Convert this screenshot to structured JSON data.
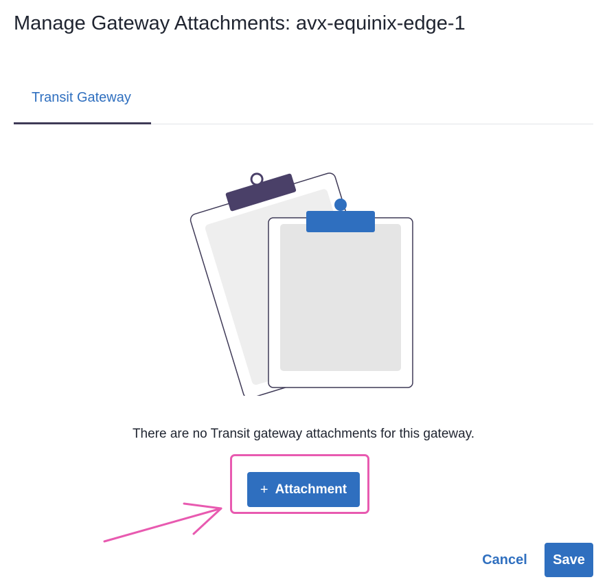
{
  "dialog": {
    "title": "Manage Gateway Attachments: avx-equinix-edge-1"
  },
  "tabs": [
    {
      "label": "Transit Gateway",
      "active": true
    }
  ],
  "empty_state": {
    "illustration": "clipboards-illustration",
    "message": "There are no Transit gateway attachments for this gateway."
  },
  "add_button": {
    "icon": "plus-icon",
    "icon_glyph": "+",
    "label": "Attachment"
  },
  "footer": {
    "cancel_label": "Cancel",
    "save_label": "Save"
  },
  "colors": {
    "accent": "#2f6fbf",
    "tab_underline": "#3f3a57",
    "annotation": "#e85ab0"
  }
}
